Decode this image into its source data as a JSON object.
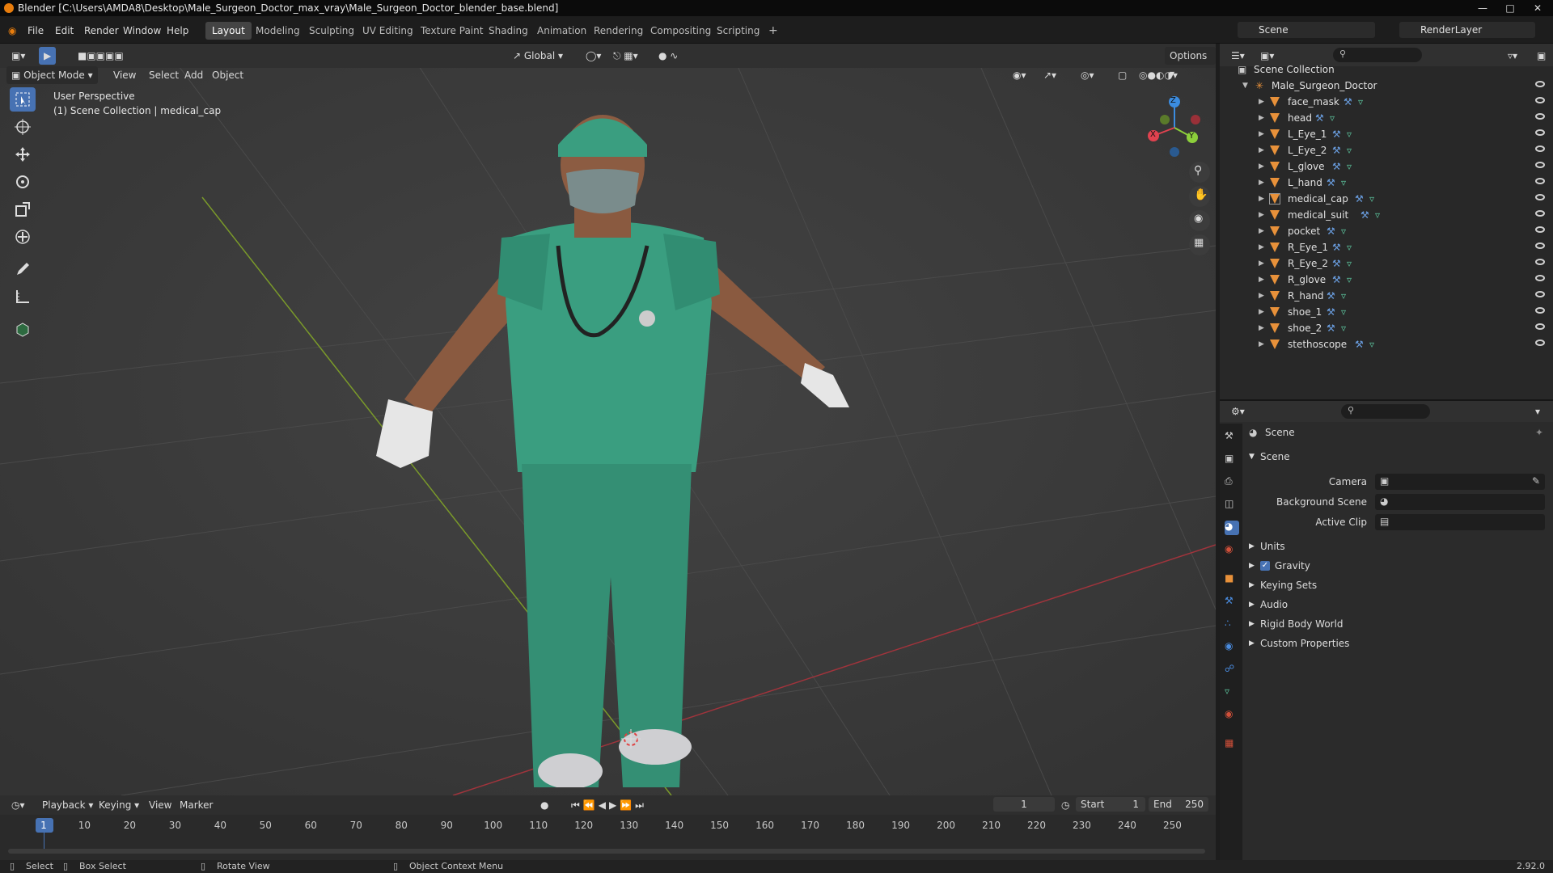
{
  "window": {
    "title": "Blender [C:\\Users\\AMDA8\\Desktop\\Male_Surgeon_Doctor_max_vray\\Male_Surgeon_Doctor_blender_base.blend]"
  },
  "menu": [
    "File",
    "Edit",
    "Render",
    "Window",
    "Help"
  ],
  "workspaces": [
    "Layout",
    "Modeling",
    "Sculpting",
    "UV Editing",
    "Texture Paint",
    "Shading",
    "Animation",
    "Rendering",
    "Compositing",
    "Scripting"
  ],
  "active_workspace": "Layout",
  "scene_field": "Scene",
  "renderlayer_field": "RenderLayer",
  "viewport": {
    "mode": "Object Mode",
    "menus": [
      "View",
      "Select",
      "Add",
      "Object"
    ],
    "transform_orientation": "Global",
    "options_label": "Options",
    "overlay_line1": "User Perspective",
    "overlay_line2": "(1) Scene Collection | medical_cap"
  },
  "gizmo_axes": [
    "X",
    "Y",
    "Z"
  ],
  "outliner": {
    "root": "Scene Collection",
    "collection": "Male_Surgeon_Doctor",
    "objects": [
      "face_mask",
      "head",
      "L_Eye_1",
      "L_Eye_2",
      "L_glove",
      "L_hand",
      "medical_cap",
      "medical_suit",
      "pocket",
      "R_Eye_1",
      "R_Eye_2",
      "R_glove",
      "R_hand",
      "shoe_1",
      "shoe_2",
      "stethoscope"
    ],
    "selected": "medical_cap"
  },
  "properties": {
    "context": "Scene",
    "panel_title": "Scene",
    "fields": [
      "Camera",
      "Background Scene",
      "Active Clip"
    ],
    "panels": [
      "Units",
      "Gravity",
      "Keying Sets",
      "Audio",
      "Rigid Body World",
      "Custom Properties"
    ],
    "gravity_checked": true
  },
  "timeline": {
    "menus": [
      "Playback",
      "Keying",
      "View",
      "Marker"
    ],
    "current_frame": "1",
    "start_label": "Start",
    "start_value": "1",
    "end_label": "End",
    "end_value": "250",
    "ticks": [
      "1",
      "10",
      "20",
      "30",
      "40",
      "50",
      "60",
      "70",
      "80",
      "90",
      "100",
      "110",
      "120",
      "130",
      "140",
      "150",
      "160",
      "170",
      "180",
      "190",
      "200",
      "210",
      "220",
      "230",
      "240",
      "250"
    ]
  },
  "statusbar": {
    "select": "Select",
    "box_select": "Box Select",
    "rotate": "Rotate View",
    "context_menu": "Object Context Menu",
    "version": "2.92.0"
  },
  "colors": {
    "accent": "#4772b3",
    "object_icon": "#e8913a",
    "mesh_icon": "#5ec9a1",
    "x_axis": "#e0424f",
    "y_axis": "#8ccf3b",
    "z_axis": "#3b8ce0"
  }
}
